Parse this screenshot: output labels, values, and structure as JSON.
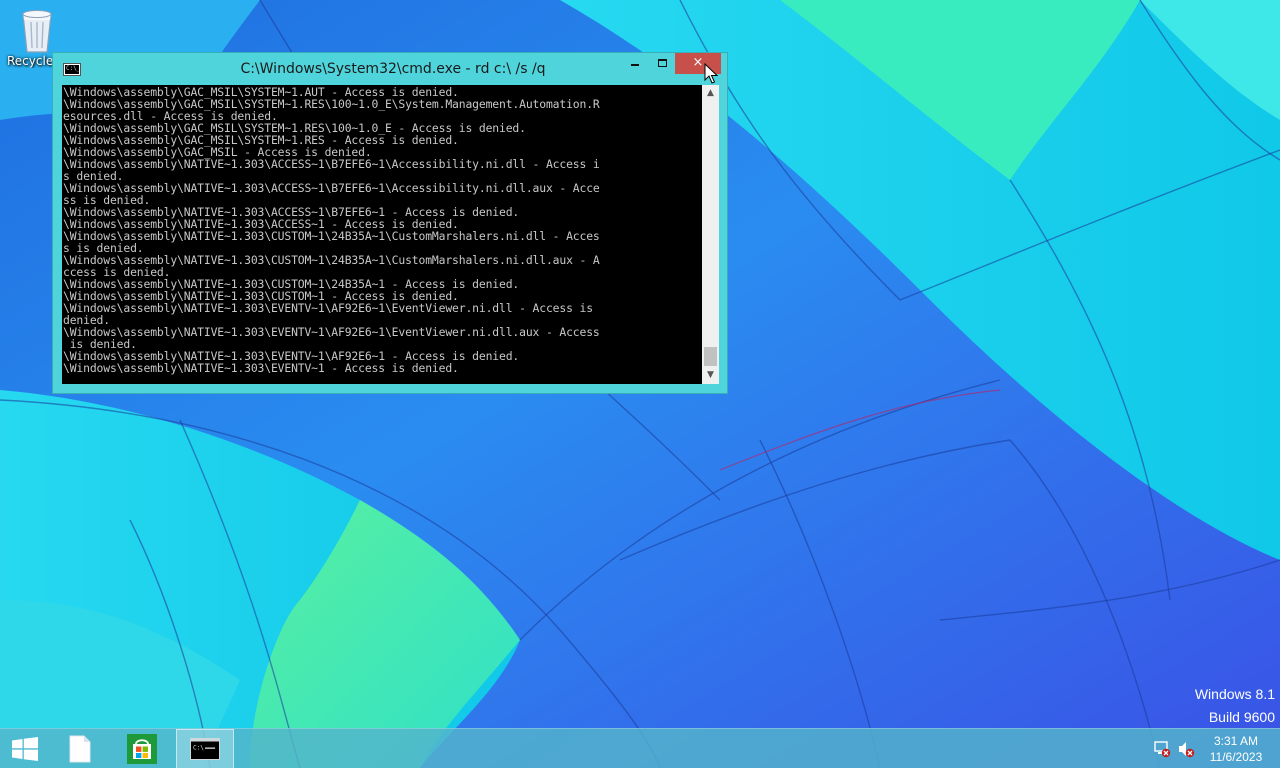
{
  "desktop": {
    "icons": [
      {
        "label": "Recycle Bin",
        "icon": "recycle-bin-icon"
      }
    ],
    "watermark": {
      "line1": "Windows 8.1",
      "line2": "Build 9600"
    }
  },
  "window": {
    "title": "C:\\Windows\\System32\\cmd.exe - rd  c:\\ /s /q",
    "controls": {
      "minimize": "minimize",
      "maximize": "maximize",
      "close": "×"
    },
    "console_lines": [
      "\\Windows\\assembly\\GAC_MSIL\\SYSTEM~1.AUT - Access is denied.",
      "\\Windows\\assembly\\GAC_MSIL\\SYSTEM~1.RES\\100~1.0_E\\System.Management.Automation.R",
      "esources.dll - Access is denied.",
      "\\Windows\\assembly\\GAC_MSIL\\SYSTEM~1.RES\\100~1.0_E - Access is denied.",
      "\\Windows\\assembly\\GAC_MSIL\\SYSTEM~1.RES - Access is denied.",
      "\\Windows\\assembly\\GAC_MSIL - Access is denied.",
      "\\Windows\\assembly\\NATIVE~1.303\\ACCESS~1\\B7EFE6~1\\Accessibility.ni.dll - Access i",
      "s denied.",
      "\\Windows\\assembly\\NATIVE~1.303\\ACCESS~1\\B7EFE6~1\\Accessibility.ni.dll.aux - Acce",
      "ss is denied.",
      "\\Windows\\assembly\\NATIVE~1.303\\ACCESS~1\\B7EFE6~1 - Access is denied.",
      "\\Windows\\assembly\\NATIVE~1.303\\ACCESS~1 - Access is denied.",
      "\\Windows\\assembly\\NATIVE~1.303\\CUSTOM~1\\24B35A~1\\CustomMarshalers.ni.dll - Acces",
      "s is denied.",
      "\\Windows\\assembly\\NATIVE~1.303\\CUSTOM~1\\24B35A~1\\CustomMarshalers.ni.dll.aux - A",
      "ccess is denied.",
      "\\Windows\\assembly\\NATIVE~1.303\\CUSTOM~1\\24B35A~1 - Access is denied.",
      "\\Windows\\assembly\\NATIVE~1.303\\CUSTOM~1 - Access is denied.",
      "\\Windows\\assembly\\NATIVE~1.303\\EVENTV~1\\AF92E6~1\\EventViewer.ni.dll - Access is",
      "denied.",
      "\\Windows\\assembly\\NATIVE~1.303\\EVENTV~1\\AF92E6~1\\EventViewer.ni.dll.aux - Access",
      " is denied.",
      "\\Windows\\assembly\\NATIVE~1.303\\EVENTV~1\\AF92E6~1 - Access is denied.",
      "\\Windows\\assembly\\NATIVE~1.303\\EVENTV~1 - Access is denied."
    ],
    "scrollbar": {
      "up": "▲",
      "down": "▼"
    }
  },
  "taskbar": {
    "buttons": [
      {
        "name": "start",
        "icon": "windows-logo-icon"
      },
      {
        "name": "file-explorer",
        "icon": "file-icon"
      },
      {
        "name": "store",
        "icon": "store-icon"
      },
      {
        "name": "command-prompt",
        "icon": "cmd-icon",
        "active": true
      }
    ],
    "tray": {
      "network_icon": "network-disconnected-icon",
      "volume_icon": "volume-muted-icon"
    },
    "clock": {
      "time": "3:31 AM",
      "date": "11/6/2023"
    }
  },
  "colors": {
    "window_frame": "#4fd4dc",
    "close_button": "#c7504b",
    "taskbar": "#54b4ca",
    "console_bg": "#000000",
    "console_text": "#c8c8c8"
  }
}
